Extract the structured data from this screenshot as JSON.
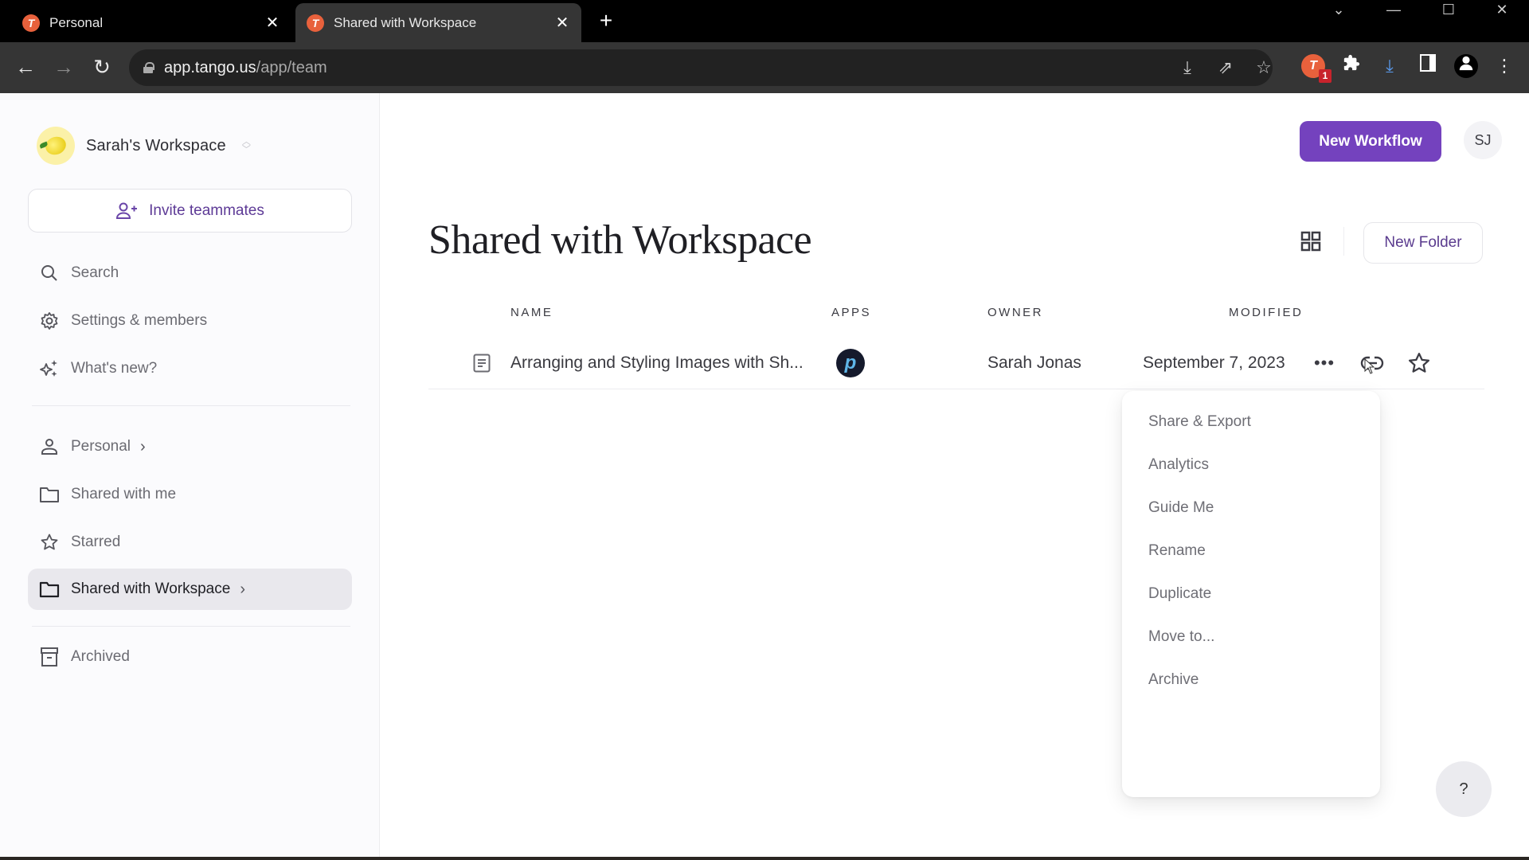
{
  "browser": {
    "tabs": [
      {
        "title": "Personal",
        "active": false
      },
      {
        "title": "Shared with Workspace",
        "active": true
      }
    ],
    "new_tab_label": "+",
    "url_host": "app.tango.us",
    "url_path": "/app/team",
    "extension_badge": "1",
    "tab_favicon_letter": "T"
  },
  "sidebar": {
    "workspace_name": "Sarah's Workspace",
    "invite_label": "Invite teammates",
    "tools": [
      {
        "label": "Search",
        "icon": "search-icon"
      },
      {
        "label": "Settings & members",
        "icon": "gear-icon"
      },
      {
        "label": "What's new?",
        "icon": "sparkles-icon"
      }
    ],
    "folders": [
      {
        "label": "Personal",
        "icon": "person-icon",
        "has_chevron": true
      },
      {
        "label": "Shared with me",
        "icon": "folder-icon",
        "has_chevron": false
      },
      {
        "label": "Starred",
        "icon": "star-icon",
        "has_chevron": false
      },
      {
        "label": "Shared with Workspace",
        "icon": "folder-icon",
        "has_chevron": true,
        "active": true
      }
    ],
    "archived_label": "Archived"
  },
  "header": {
    "new_workflow_label": "New Workflow",
    "user_initials": "SJ",
    "accent_color": "#7442be"
  },
  "main": {
    "title": "Shared with Workspace",
    "new_folder_label": "New Folder",
    "columns": {
      "name": "NAME",
      "apps": "APPS",
      "owner": "OWNER",
      "modified": "MODIFIED"
    },
    "rows": [
      {
        "name": "Arranging and Styling Images with Sh...",
        "app_icon": "picsart-icon",
        "owner": "Sarah Jonas",
        "modified": "September 7, 2023"
      }
    ]
  },
  "context_menu": {
    "items": [
      "Share & Export",
      "Analytics",
      "Guide Me",
      "Rename",
      "Duplicate",
      "Move to...",
      "Archive"
    ]
  },
  "help_label": "?"
}
